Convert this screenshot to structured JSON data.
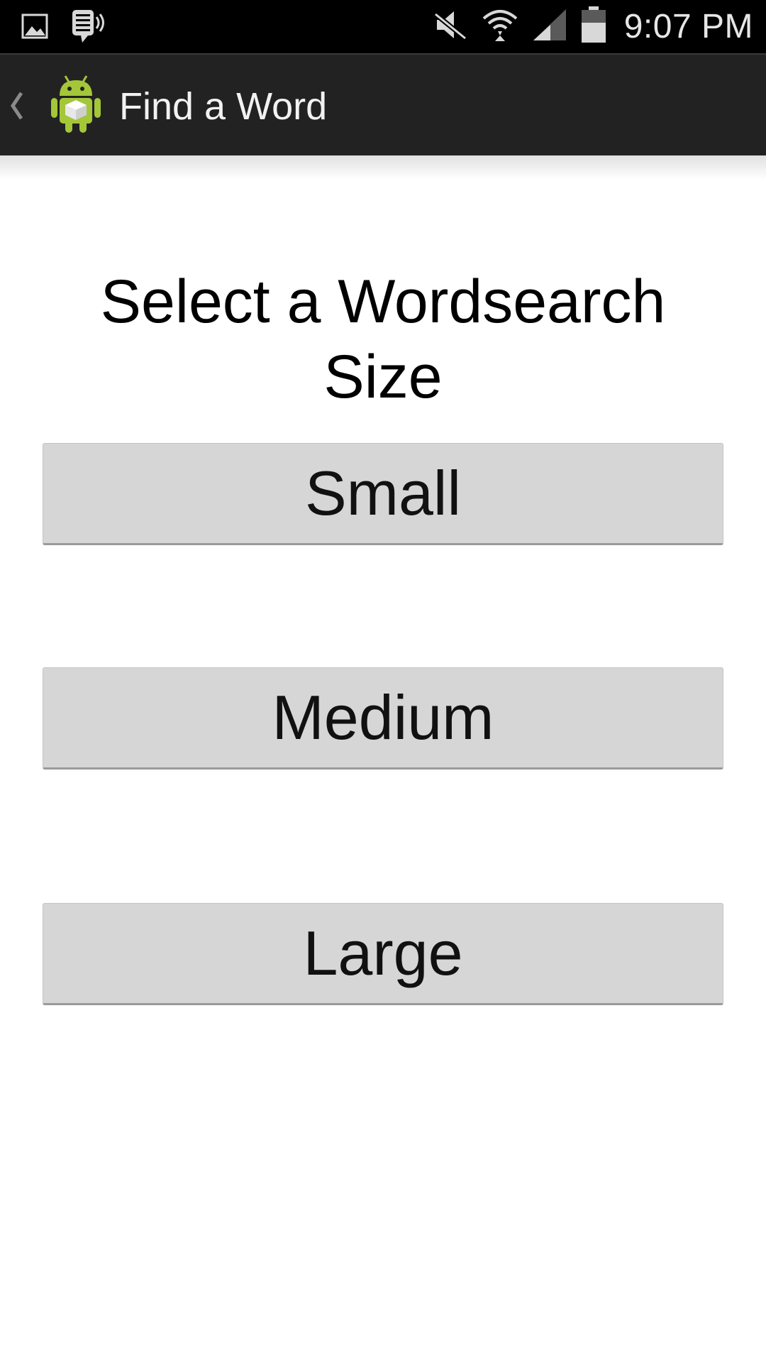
{
  "status_bar": {
    "time": "9:07 PM",
    "icons": [
      "gallery-icon",
      "voicemail-icon",
      "mute-icon",
      "wifi-icon",
      "signal-icon",
      "battery-icon"
    ]
  },
  "action_bar": {
    "title": "Find a Word",
    "icons": [
      "up-caret-icon",
      "android-app-icon"
    ]
  },
  "main": {
    "heading_line1": "Select a Wordsearch",
    "heading_line2": "Size",
    "buttons": [
      {
        "label": "Small"
      },
      {
        "label": "Medium"
      },
      {
        "label": "Large"
      }
    ]
  },
  "colors": {
    "status_bar_bg": "#000000",
    "action_bar_bg": "#222222",
    "button_bg": "#d6d6d6",
    "android_green": "#a4c639"
  }
}
